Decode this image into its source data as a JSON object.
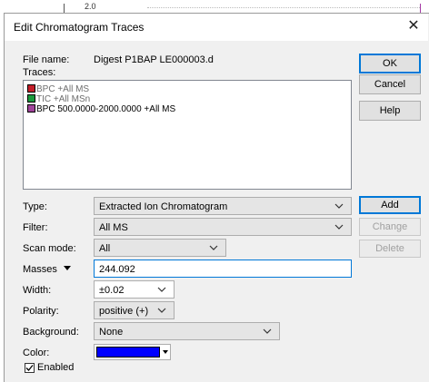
{
  "background": {
    "axis_tick_label": "2.0"
  },
  "dialog": {
    "title": "Edit Chromatogram Traces",
    "close_glyph": "✕"
  },
  "file": {
    "label": "File name:",
    "value": "Digest P1BAP LE000003.d"
  },
  "traces": {
    "label": "Traces:",
    "items": [
      {
        "text": "BPC +All MS",
        "color": "#c41e2a",
        "muted": true
      },
      {
        "text": "TIC +All MSn",
        "color": "#1a9a3c",
        "muted": true
      },
      {
        "text": "BPC 500.0000-2000.0000 +All MS",
        "color": "#a0449a",
        "muted": false
      }
    ]
  },
  "buttons": {
    "ok": "OK",
    "cancel": "Cancel",
    "help": "Help",
    "add": "Add",
    "change": "Change",
    "delete": "Delete"
  },
  "form": {
    "type": {
      "label": "Type:",
      "value": "Extracted Ion Chromatogram"
    },
    "filter": {
      "label": "Filter:",
      "value": "All MS"
    },
    "scan_mode": {
      "label": "Scan mode:",
      "value": "All"
    },
    "masses": {
      "label": "Masses",
      "value": "244.092"
    },
    "width": {
      "label": "Width:",
      "value": "±0.02"
    },
    "polarity": {
      "label": "Polarity:",
      "value": "positive (+)"
    },
    "background": {
      "label": "Background:",
      "value": "None"
    },
    "color": {
      "label": "Color:",
      "swatch": "#0000ff"
    },
    "enabled": {
      "label": "Enabled",
      "checked": true
    }
  },
  "colors": {
    "accent": "#0078d7",
    "dialog_bg": "#f0f0f0",
    "disabled_text": "#a0a0a0"
  },
  "icons": {
    "dropdown": "chevron-down-icon",
    "close": "close-icon",
    "masses_menu": "triangle-down-icon",
    "check": "checkmark-icon"
  }
}
